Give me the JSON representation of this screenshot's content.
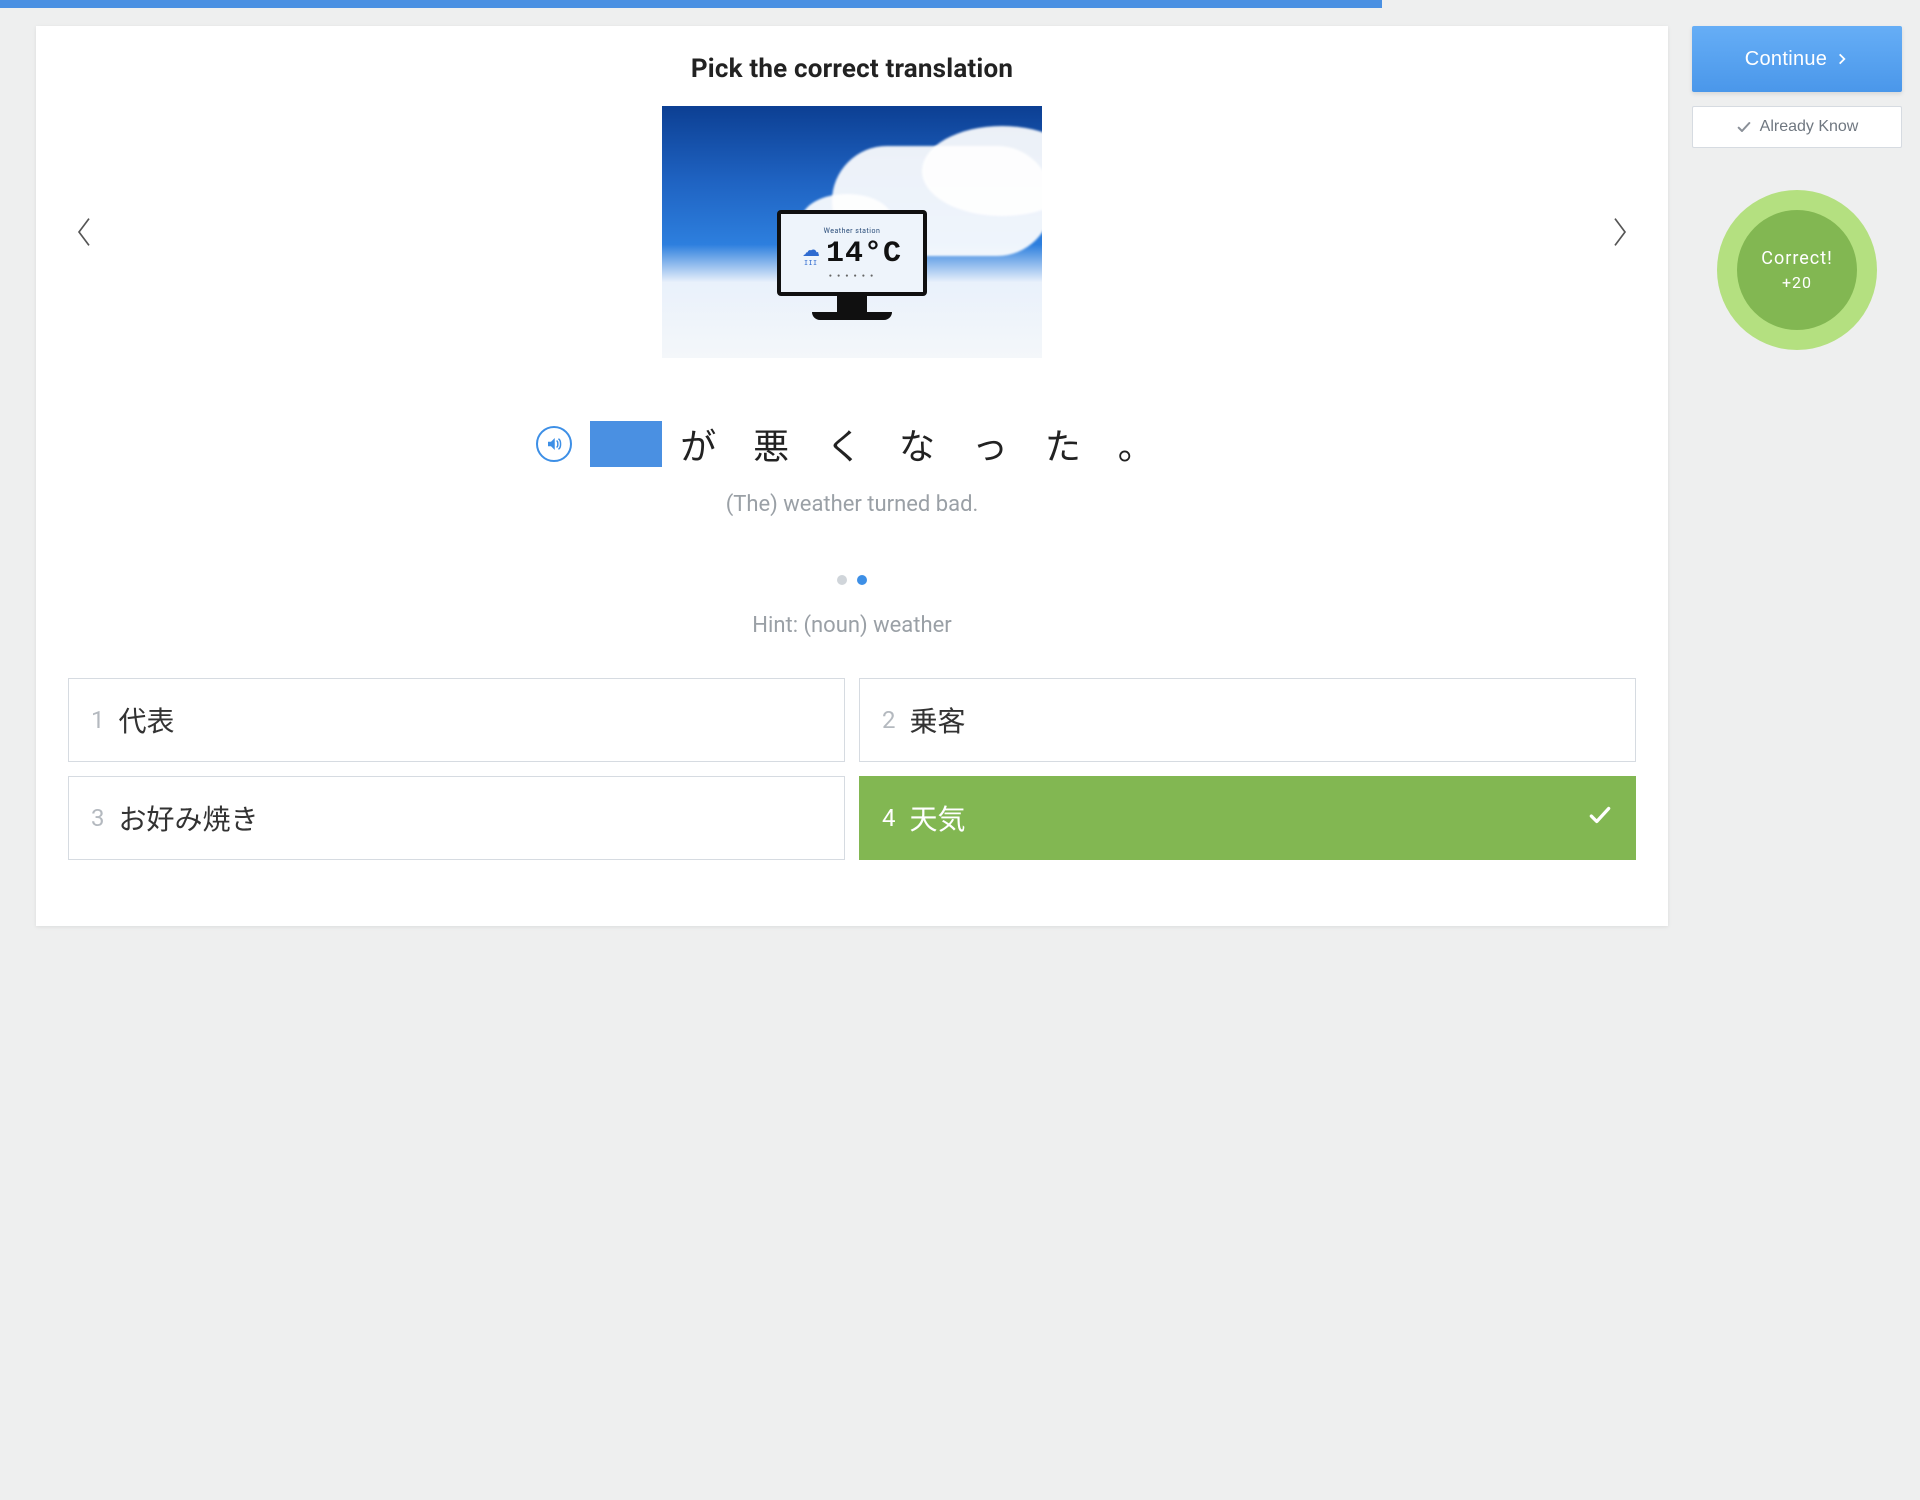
{
  "progress": {
    "percent": 72
  },
  "card": {
    "title": "Pick the correct translation",
    "image": {
      "weather_station_label": "Weather  station",
      "temperature": "14°C"
    },
    "sentence_jp": "が 悪 く な っ た 。",
    "translation_en": "(The) weather turned bad.",
    "pager": {
      "total_dots": 2,
      "active_index": 1
    },
    "hint": "Hint: (noun) weather",
    "options": [
      {
        "num": "1",
        "label": "代表",
        "correct": false
      },
      {
        "num": "2",
        "label": "乗客",
        "correct": false
      },
      {
        "num": "3",
        "label": "お好み焼き",
        "correct": false
      },
      {
        "num": "4",
        "label": "天気",
        "correct": true
      }
    ]
  },
  "sidebar": {
    "continue_label": "Continue",
    "already_know_label": "Already Know",
    "correct_label": "Correct!",
    "points_label": "+20"
  }
}
